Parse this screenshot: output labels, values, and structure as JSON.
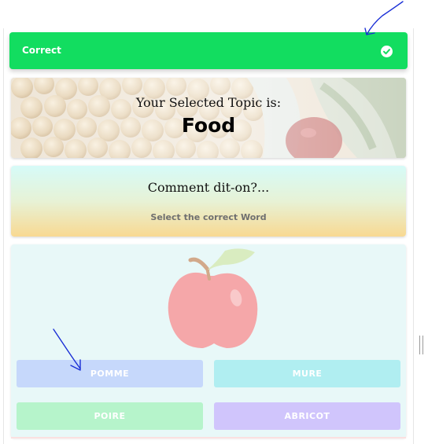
{
  "toast": {
    "label": "Correct",
    "icon": "check-circle-icon",
    "color": "#12dd60"
  },
  "topic": {
    "heading": "Your Selected Topic is:",
    "name": "Food"
  },
  "question": {
    "prompt": "Comment dit-on?...",
    "instruction": "Select the correct Word"
  },
  "answer": {
    "image_icon": "apple-icon",
    "options": [
      "POMME",
      "MURE",
      "POIRE",
      "ABRICOT"
    ],
    "option_colors": [
      "#c6d8fb",
      "#b0eef1",
      "#b6f4cb",
      "#d0c5fc"
    ]
  },
  "annotations": {
    "color": "#1a2fd6",
    "marks": [
      "arrow-to-check-icon",
      "arrow-to-pomme-option"
    ]
  }
}
